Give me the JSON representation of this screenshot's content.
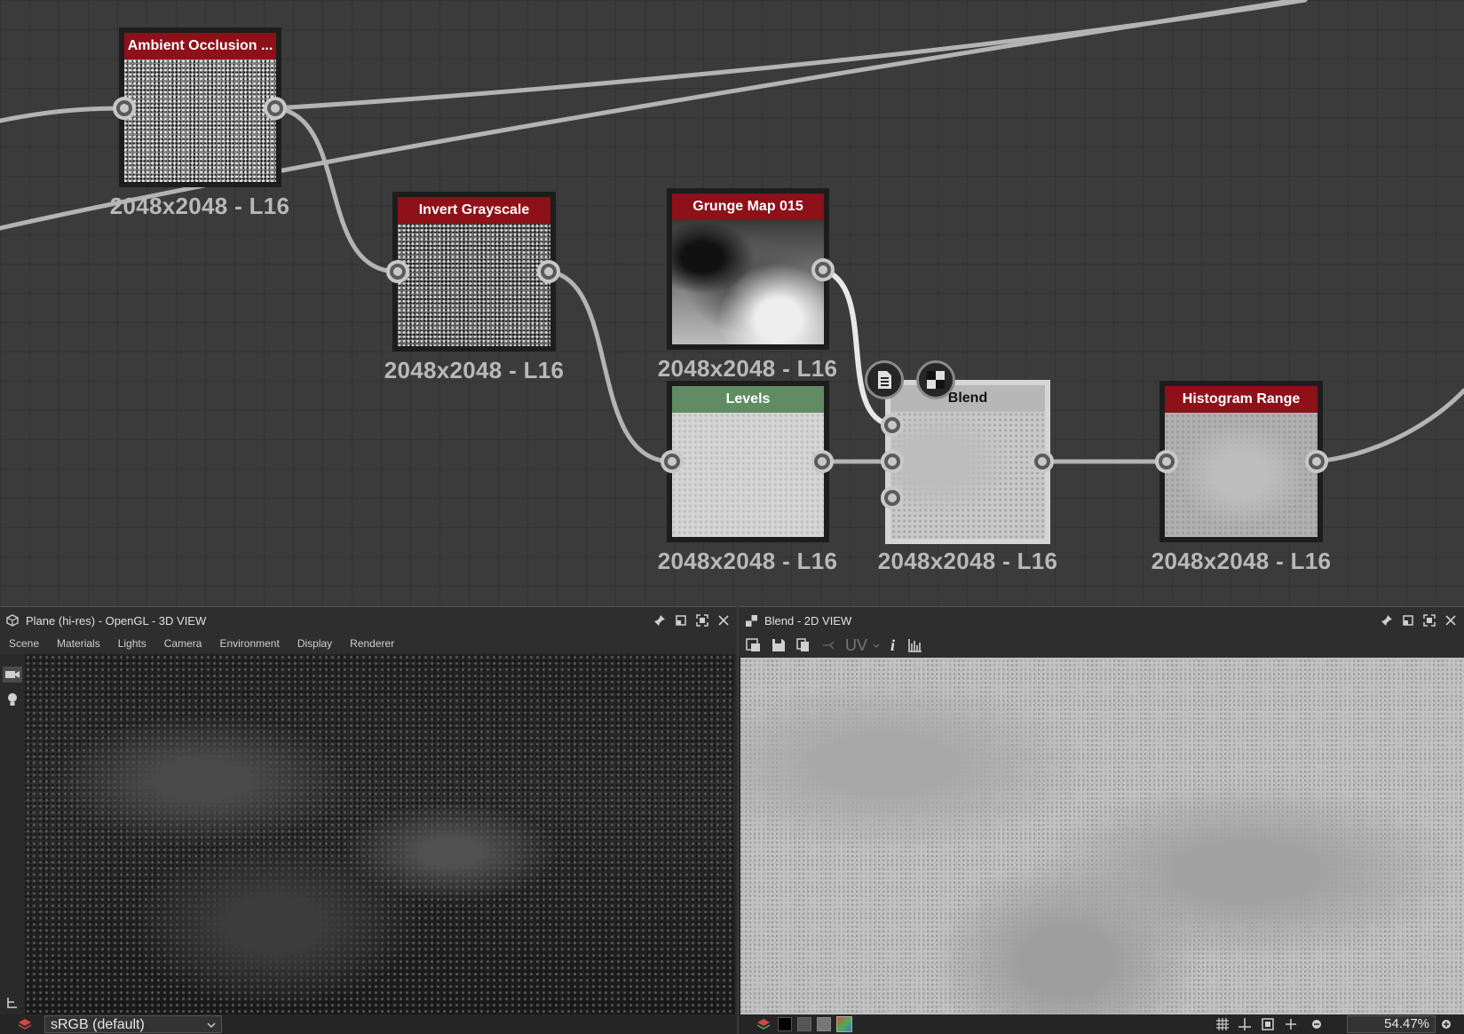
{
  "graph": {
    "nodes": [
      {
        "id": "ao",
        "title": "Ambient Occlusion ...",
        "size_label": "2048x2048 - L16",
        "header_color": "#8e1018"
      },
      {
        "id": "invert",
        "title": "Invert Grayscale",
        "size_label": "2048x2048 - L16",
        "header_color": "#8e1018"
      },
      {
        "id": "grunge",
        "title": "Grunge Map 015",
        "size_label": "2048x2048 - L16",
        "header_color": "#8e1018"
      },
      {
        "id": "levels",
        "title": "Levels",
        "size_label": "2048x2048 - L16",
        "header_color": "#5f8c63"
      },
      {
        "id": "blend",
        "title": "Blend",
        "size_label": "2048x2048 - L16",
        "header_color": "#b7b7b7"
      },
      {
        "id": "histogram",
        "title": "Histogram Range",
        "size_label": "2048x2048 - L16",
        "header_color": "#8e1018"
      }
    ]
  },
  "view3d": {
    "title": "Plane (hi-res) - OpenGL - 3D VIEW",
    "menu": [
      "Scene",
      "Materials",
      "Lights",
      "Camera",
      "Environment",
      "Display",
      "Renderer"
    ],
    "colorspace": "sRGB (default)"
  },
  "view2d": {
    "title": "Blend - 2D VIEW",
    "uv_label": "UV",
    "info_label": "i",
    "zoom": "54.47%"
  }
}
